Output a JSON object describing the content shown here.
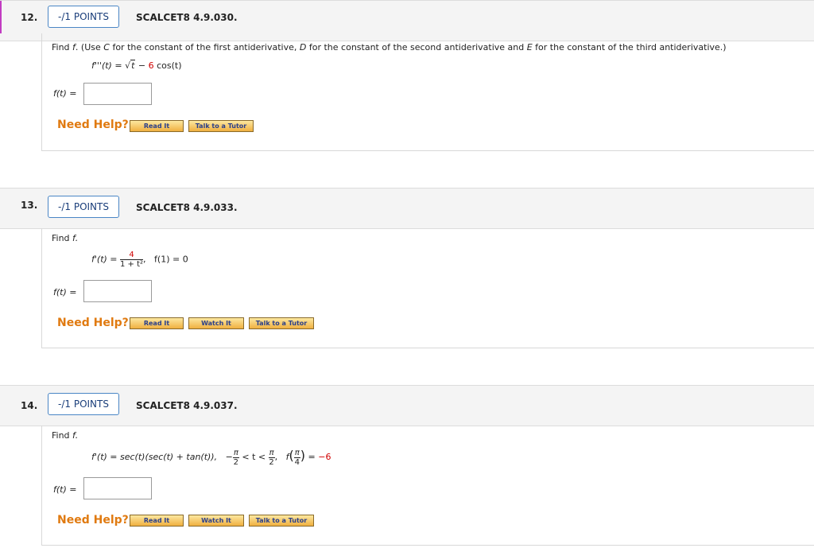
{
  "questions": [
    {
      "number": "12.",
      "points": "-/1 POINTS",
      "code": "SCALCET8 4.9.030.",
      "prompt_a": "Find ",
      "prompt_f": "f",
      "prompt_b": ". (Use ",
      "prompt_c": "C",
      "prompt_d": " for the constant of the first antiderivative, ",
      "prompt_e": "D",
      "prompt_g": " for the constant of the second antiderivative and ",
      "prompt_h": "E",
      "prompt_i": " for the constant of the third antiderivative.)",
      "eq_lhs": "f'''(t) = ",
      "eq_sqrt_arg": "t",
      "eq_minus": " − ",
      "eq_coef": "6",
      "eq_rest": " cos(t)",
      "answer_label": "f(t) =",
      "need_help": "Need Help?",
      "buttons": [
        "Read It",
        "Talk to a Tutor"
      ]
    },
    {
      "number": "13.",
      "points": "-/1 POINTS",
      "code": "SCALCET8 4.9.033.",
      "prompt": "Find ",
      "prompt_f": "f.",
      "eq_lhs": "f'(t) = ",
      "eq_num": "4",
      "eq_den": "1 + t²",
      "eq_comma": ",",
      "eq_cond": "f(1) = 0",
      "answer_label": "f(t) =",
      "need_help": "Need Help?",
      "buttons": [
        "Read It",
        "Watch It",
        "Talk to a Tutor"
      ]
    },
    {
      "number": "14.",
      "points": "-/1 POINTS",
      "code": "SCALCET8 4.9.037.",
      "prompt": "Find ",
      "prompt_f": "f.",
      "eq_lhs": "f'(t) = sec(t)(sec(t) + tan(t)),",
      "ineq_minus": "−",
      "ineq_num": "π",
      "ineq_den": "2",
      "ineq_mid": " < t < ",
      "cond_f": "f",
      "cond_num": "π",
      "cond_den": "4",
      "cond_eq": " = ",
      "cond_val": "−6",
      "answer_label": "f(t) =",
      "need_help": "Need Help?",
      "buttons": [
        "Read It",
        "Watch It",
        "Talk to a Tutor"
      ]
    }
  ],
  "colors": {
    "need_help": "#e07a10",
    "red_value": "#d00000",
    "points_border": "#4a86c5",
    "left_marker": "#c23cc2"
  }
}
